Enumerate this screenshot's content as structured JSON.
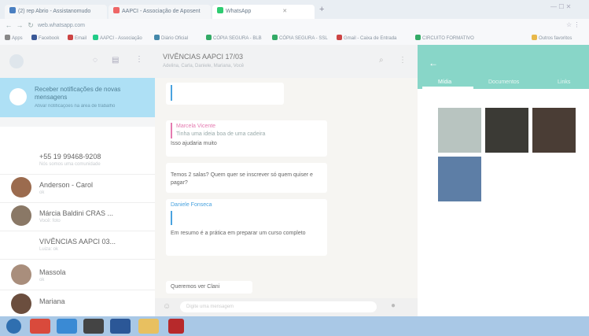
{
  "browser": {
    "tabs": [
      {
        "label": "(2) rep Abrio - Assistanomudo",
        "icon_color": "#4a7fc1"
      },
      {
        "label": "AAPCI - Associação de Aposent",
        "icon_color": "#e66"
      },
      {
        "label": "WhatsApp",
        "icon_color": "#2ecc71"
      }
    ],
    "url": "web.whatsapp.com",
    "bookmarks": [
      {
        "label": "Apps",
        "color": "#888"
      },
      {
        "label": "Facebook",
        "color": "#3b5998"
      },
      {
        "label": "Email",
        "color": "#c44"
      },
      {
        "label": "AAPCI - Associação",
        "color": "#2c8"
      },
      {
        "label": "Diário Oficial",
        "color": "#48a"
      },
      {
        "label": "CÓPIA SEGURA - BLB",
        "color": "#3a6"
      },
      {
        "label": "CÓPIA SEGURA - SSL",
        "color": "#3a6"
      },
      {
        "label": "Gmail - Caixa de Entrada",
        "color": "#c44"
      },
      {
        "label": "CIRCUITO FORMATIVO",
        "color": "#3a6"
      },
      {
        "label": "Outros favoritos",
        "color": "#e8b84a"
      }
    ]
  },
  "notification": {
    "title": "Receber notificações de novas mensagens",
    "subtitle": "Ativar notificações na área de trabalho"
  },
  "chats": [
    {
      "name": "+55 19 99468-9208",
      "sub": "Nós somos uma comunidade",
      "avatar": "#ffffff"
    },
    {
      "name": "Anderson - Carol",
      "sub": "ok",
      "avatar": "#9b6b4e"
    },
    {
      "name": "Márcia Baldini CRAS ...",
      "sub": "Você: foto",
      "avatar": "#8a7866"
    },
    {
      "name": "VIVÊNCIAS AAPCI 03...",
      "sub": "Luiza: ok",
      "avatar": "#ffffff"
    },
    {
      "name": "Massola",
      "sub": "ok",
      "avatar": "#a98e7c"
    },
    {
      "name": "Mariana",
      "sub": "",
      "avatar": "#6b4e3e"
    }
  ],
  "conversation": {
    "title": "VIVÊNCIAS AAPCI 17/03",
    "subtitle": "Adelina, Carla, Daniele, Mariana, Você",
    "messages": [
      {
        "author": "Marcela Vicente",
        "text": "Tinha uma ideia boa de uma cadeira",
        "author_color": "#e57ab0"
      },
      {
        "author": "",
        "text": "Isso ajudaria muito",
        "author_color": ""
      },
      {
        "author": "",
        "text": "Temos 2 salas? Quem quer se inscrever só quem quiser e pagar?",
        "author_color": ""
      },
      {
        "author": "Daniele Fonseca",
        "text": "Em resumo é a prática em preparar um curso completo",
        "author_color": "#4aa3df"
      },
      {
        "author": "",
        "text": "Queremos ver Clani",
        "author_color": ""
      }
    ],
    "input_placeholder": "Digite uma mensagem"
  },
  "media_panel": {
    "tabs": [
      "Mídia",
      "Documentos",
      "Links"
    ],
    "thumbs": [
      "#b8c4c0",
      "#3b3a35",
      "#4a3d35",
      "#5d7ea6"
    ]
  },
  "taskbar": {
    "apps": [
      {
        "name": "start",
        "color": "#2f6fb0"
      },
      {
        "name": "chrome",
        "color": "#d94a3c"
      },
      {
        "name": "ie",
        "color": "#3a8ad4"
      },
      {
        "name": "media",
        "color": "#444"
      },
      {
        "name": "word",
        "color": "#2b5797"
      },
      {
        "name": "folder",
        "color": "#e8c060"
      },
      {
        "name": "acrobat",
        "color": "#b7292b"
      }
    ]
  }
}
